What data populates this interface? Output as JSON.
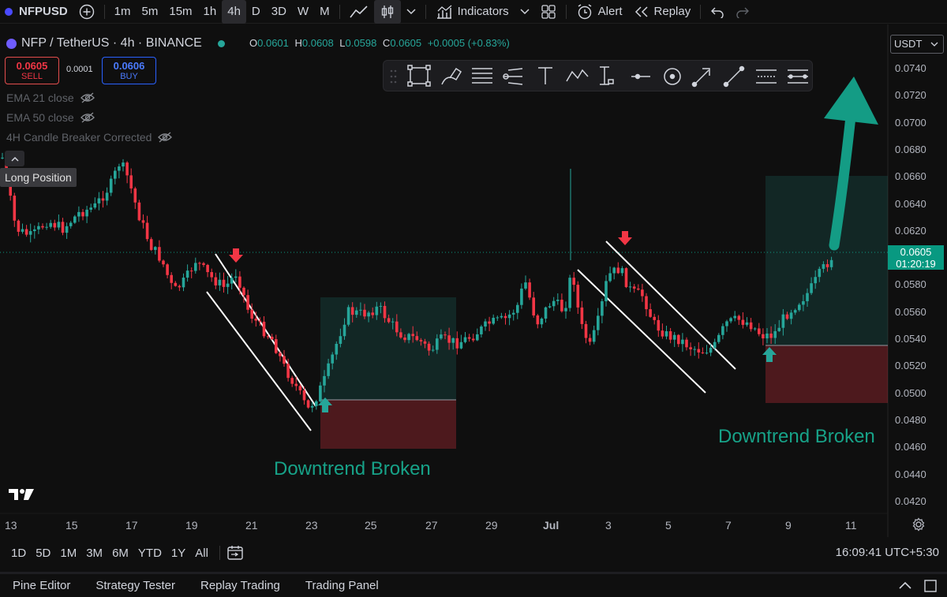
{
  "toolbar": {
    "symbol": "NFPUSD",
    "intervals": [
      "1m",
      "5m",
      "15m",
      "1h",
      "4h",
      "D",
      "3D",
      "W",
      "M"
    ],
    "active_interval": "4h",
    "indicators_label": "Indicators",
    "alert_label": "Alert",
    "replay_label": "Replay"
  },
  "legend": {
    "title": "NFP / TetherUS · 4h · BINANCE",
    "open_label": "O",
    "open": "0.0601",
    "high_label": "H",
    "high": "0.0608",
    "low_label": "L",
    "low": "0.0598",
    "close_label": "C",
    "close": "0.0605",
    "change": "+0.0005 (+0.83%)"
  },
  "trade": {
    "sell_price": "0.0605",
    "sell_label": "SELL",
    "spread": "0.0001",
    "buy_price": "0.0606",
    "buy_label": "BUY"
  },
  "indicators": [
    "EMA 21 close",
    "EMA 50 close",
    "4H Candle Breaker Corrected"
  ],
  "position_label": "Long Position",
  "currency": "USDT",
  "price_axis": [
    "0.0740",
    "0.0720",
    "0.0700",
    "0.0680",
    "0.0660",
    "0.0640",
    "0.0620",
    "0.0600",
    "0.0580",
    "0.0560",
    "0.0540",
    "0.0520",
    "0.0500",
    "0.0480",
    "0.0460",
    "0.0440",
    "0.0420"
  ],
  "current_price": "0.0605",
  "countdown": "01:20:19",
  "date_axis": [
    "13",
    "15",
    "17",
    "19",
    "21",
    "23",
    "25",
    "27",
    "29",
    "Jul",
    "3",
    "5",
    "7",
    "9",
    "11"
  ],
  "annotations": [
    "Downtrend Broken",
    "Downtrend Broken"
  ],
  "ranges": [
    "1D",
    "5D",
    "1M",
    "3M",
    "6M",
    "YTD",
    "1Y",
    "All"
  ],
  "clock": "16:09:41 UTC+5:30",
  "panels": [
    "Pine Editor",
    "Strategy Tester",
    "Replay Trading",
    "Trading Panel"
  ],
  "colors": {
    "up": "#26a69a",
    "down": "#f23645",
    "accent": "#089981"
  }
}
